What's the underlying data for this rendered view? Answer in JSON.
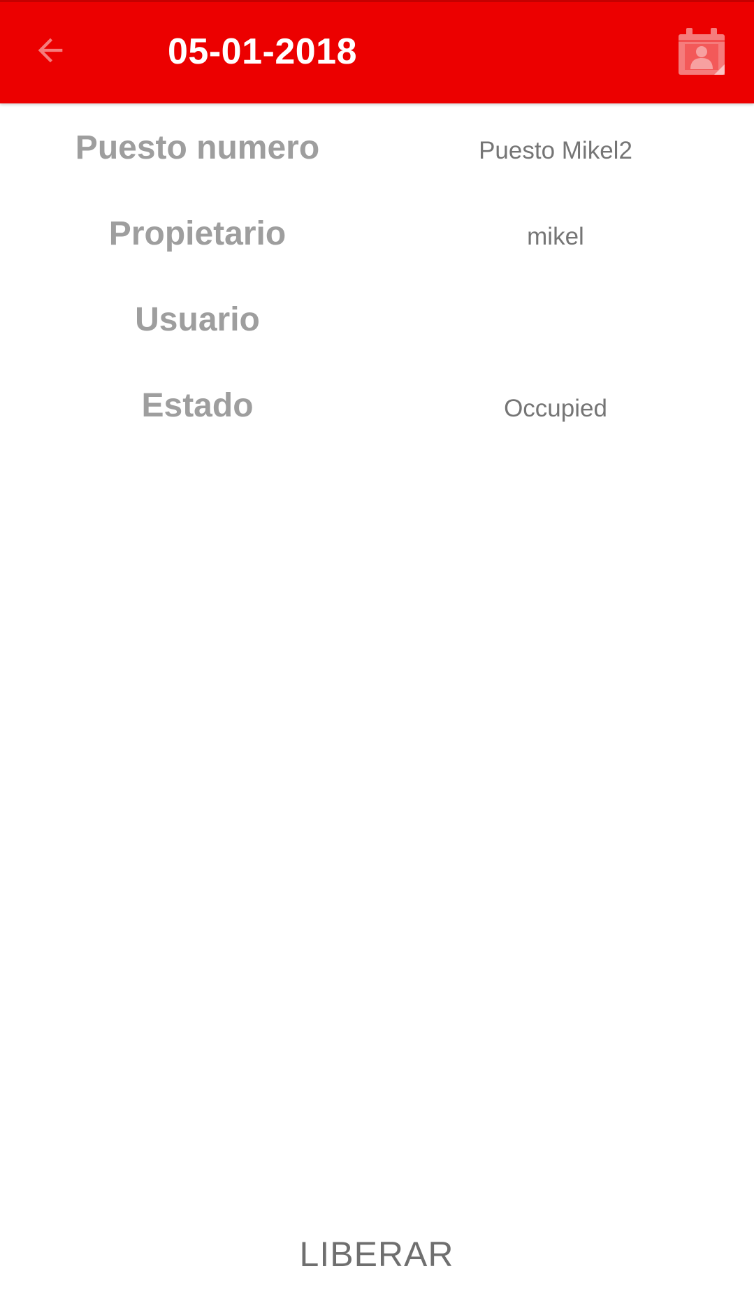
{
  "toolbar": {
    "title": "05-01-2018",
    "back_icon": "arrow-back-icon",
    "calendar_icon": "calendar-person-icon",
    "background_color": "#ec0000",
    "icon_color": "#f57c7c"
  },
  "details": {
    "rows": [
      {
        "label": "Puesto numero",
        "value": "Puesto Mikel2"
      },
      {
        "label": "Propietario",
        "value": "mikel"
      },
      {
        "label": "Usuario",
        "value": ""
      },
      {
        "label": "Estado",
        "value": "Occupied"
      }
    ]
  },
  "actions": {
    "release_label": "LIBERAR"
  }
}
